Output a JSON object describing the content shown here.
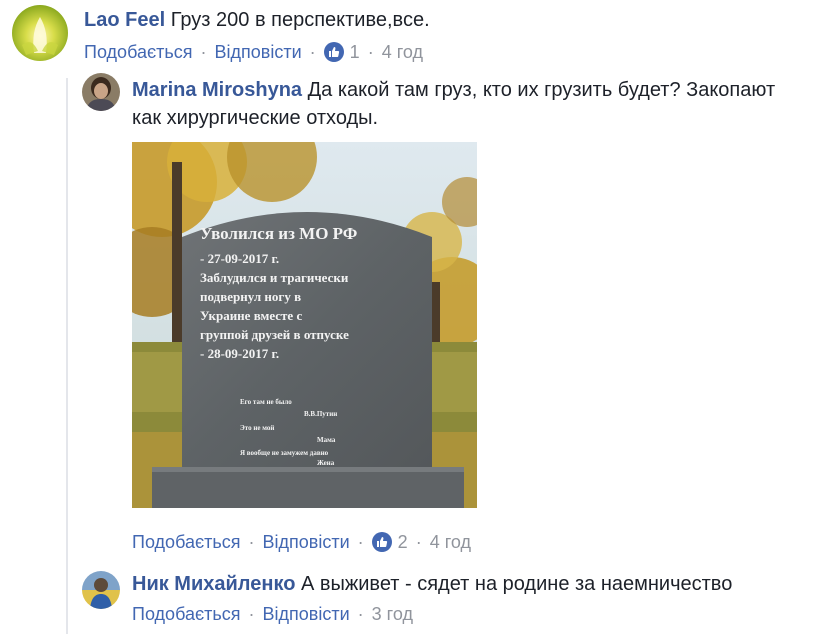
{
  "comments": [
    {
      "author": "Lao Feel",
      "text": "Груз 200 в перспективе,все.",
      "actions": {
        "like": "Подобається",
        "reply": "Відповісти"
      },
      "reactions": "1",
      "time": "4 год"
    },
    {
      "author": "Marina Miroshyna",
      "text_line1": "Да какой там груз, кто их грузить будет? Закопают",
      "text_line2": "как хирургические отходы.",
      "attachment": {
        "stone_lines": [
          "Уволился из МО РФ",
          "- 27-09-2017 г.",
          "Заблудился и трагически",
          "подвернул ногу в",
          "Украине вместе с",
          "группой друзей в отпуске",
          "- 28-09-2017 г."
        ],
        "small_lines": [
          "Его там не было",
          "В.В.Путин",
          "Это не мой",
          "Мама",
          "Я вообще не замужем давно",
          "Жена"
        ]
      },
      "actions": {
        "like": "Подобається",
        "reply": "Відповісти"
      },
      "reactions": "2",
      "time": "4 год"
    },
    {
      "author": "Ник Михайленко",
      "text": "А выживет - сядет на родине за наемничество",
      "actions": {
        "like": "Подобається",
        "reply": "Відповісти"
      },
      "time": "3 год"
    }
  ],
  "colors": {
    "link": "#4267b2",
    "author": "#385898",
    "meta": "#90949c",
    "text": "#1d2129"
  },
  "icons": {
    "reaction": "like-thumb-icon"
  }
}
